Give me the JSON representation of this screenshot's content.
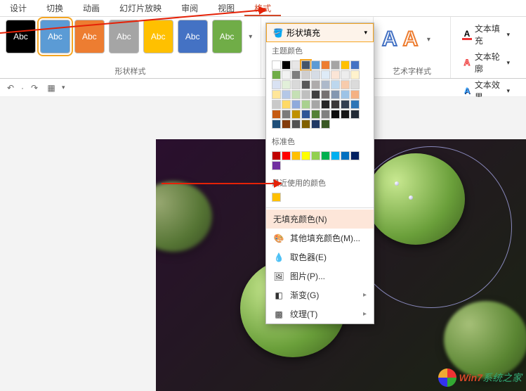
{
  "tabs": {
    "design": "设计",
    "transition": "切换",
    "animation": "动画",
    "slideshow": "幻灯片放映",
    "review": "审阅",
    "view": "视图",
    "format": "格式"
  },
  "ribbon": {
    "shape_styles_label": "形状样式",
    "wordart_styles_label": "艺术字样式",
    "abc": "Abc",
    "style_colors": [
      "#000000",
      "#5b9bd5",
      "#ed7d31",
      "#a5a5a5",
      "#ffc000",
      "#4472c4",
      "#70ad47"
    ],
    "shape_fill": "形状填充",
    "text_fill": "文本填充",
    "text_outline": "文本轮廓",
    "text_effects": "文本效果"
  },
  "dropdown": {
    "theme_colors": "主题颜色",
    "standard_colors": "标准色",
    "recent_colors": "最近使用的颜色",
    "no_fill": "无填充颜色(N)",
    "more_colors": "其他填充颜色(M)...",
    "eyedropper": "取色器(E)",
    "picture": "图片(P)...",
    "gradient": "渐变(G)",
    "texture": "纹理(T)",
    "theme_grid": [
      [
        "#ffffff",
        "#000000",
        "#e7e6e6",
        "#44546a",
        "#5b9bd5",
        "#ed7d31",
        "#a5a5a5",
        "#ffc000",
        "#4472c4",
        "#70ad47"
      ],
      [
        "#f2f2f2",
        "#7f7f7f",
        "#d0cece",
        "#d6dce5",
        "#deebf7",
        "#fbe5d6",
        "#ededed",
        "#fff2cc",
        "#d9e2f3",
        "#e2f0d9"
      ],
      [
        "#d9d9d9",
        "#595959",
        "#aeabab",
        "#adb9ca",
        "#bdd7ee",
        "#f7cbac",
        "#dbdbdb",
        "#ffe699",
        "#b4c7e7",
        "#c5e0b4"
      ],
      [
        "#bfbfbf",
        "#404040",
        "#757171",
        "#8497b0",
        "#9dc3e6",
        "#f4b183",
        "#c9c9c9",
        "#ffd966",
        "#8faadc",
        "#a9d18e"
      ],
      [
        "#a6a6a6",
        "#262626",
        "#3b3838",
        "#333f50",
        "#2e75b6",
        "#c55a11",
        "#7b7b7b",
        "#bf9000",
        "#2f5597",
        "#548235"
      ],
      [
        "#808080",
        "#0d0d0d",
        "#171717",
        "#222a35",
        "#1f4e79",
        "#843c0c",
        "#525252",
        "#806000",
        "#1f3864",
        "#385723"
      ]
    ],
    "standard_row": [
      "#c00000",
      "#ff0000",
      "#ffc000",
      "#ffff00",
      "#92d050",
      "#00b050",
      "#00b0f0",
      "#0070c0",
      "#002060",
      "#7030a0"
    ],
    "recent": [
      "#ffc000"
    ]
  },
  "watermark": {
    "brand1": "Win7",
    "brand2": "系统之家"
  }
}
